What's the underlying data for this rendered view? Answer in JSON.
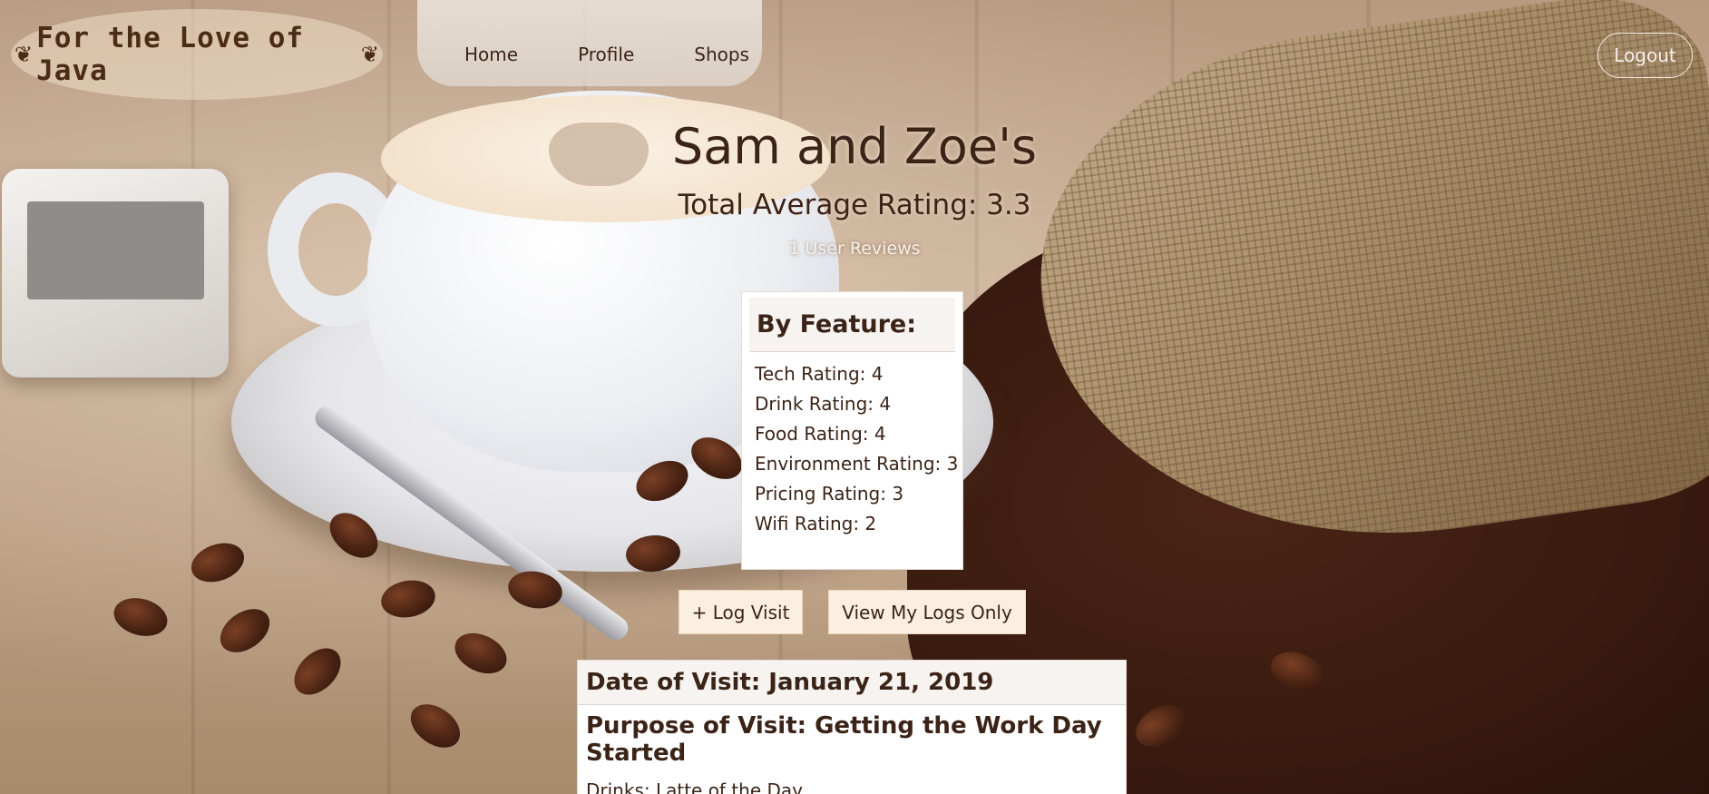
{
  "header": {
    "logo_text": "For the Love of Java",
    "leaf_glyph": "❦",
    "nav": [
      {
        "label": "Home"
      },
      {
        "label": "Profile"
      },
      {
        "label": "Shops"
      }
    ],
    "logout_label": "Logout"
  },
  "shop": {
    "name": "Sam and Zoe's",
    "average_rating_text": "Total Average Rating: 3.3",
    "review_count_text": "1 User Reviews"
  },
  "features": {
    "heading": "By Feature:",
    "items": [
      {
        "label": "Tech Rating: 4"
      },
      {
        "label": "Drink Rating: 4"
      },
      {
        "label": "Food Rating: 4"
      },
      {
        "label": "Environment Rating: 3"
      },
      {
        "label": "Pricing Rating: 3"
      },
      {
        "label": "Wifi Rating: 2"
      }
    ]
  },
  "actions": {
    "log_visit_label": "+ Log Visit",
    "view_my_logs_label": "View My Logs Only"
  },
  "visit": {
    "date_text": "Date of Visit: January 21, 2019",
    "purpose_text": "Purpose of Visit: Getting the Work Day Started",
    "drinks_text": "Drinks: Latte of the Day"
  },
  "colors": {
    "text_brown": "#3b2417",
    "button_bg": "#fbefdf",
    "card_bg": "#ffffff"
  }
}
